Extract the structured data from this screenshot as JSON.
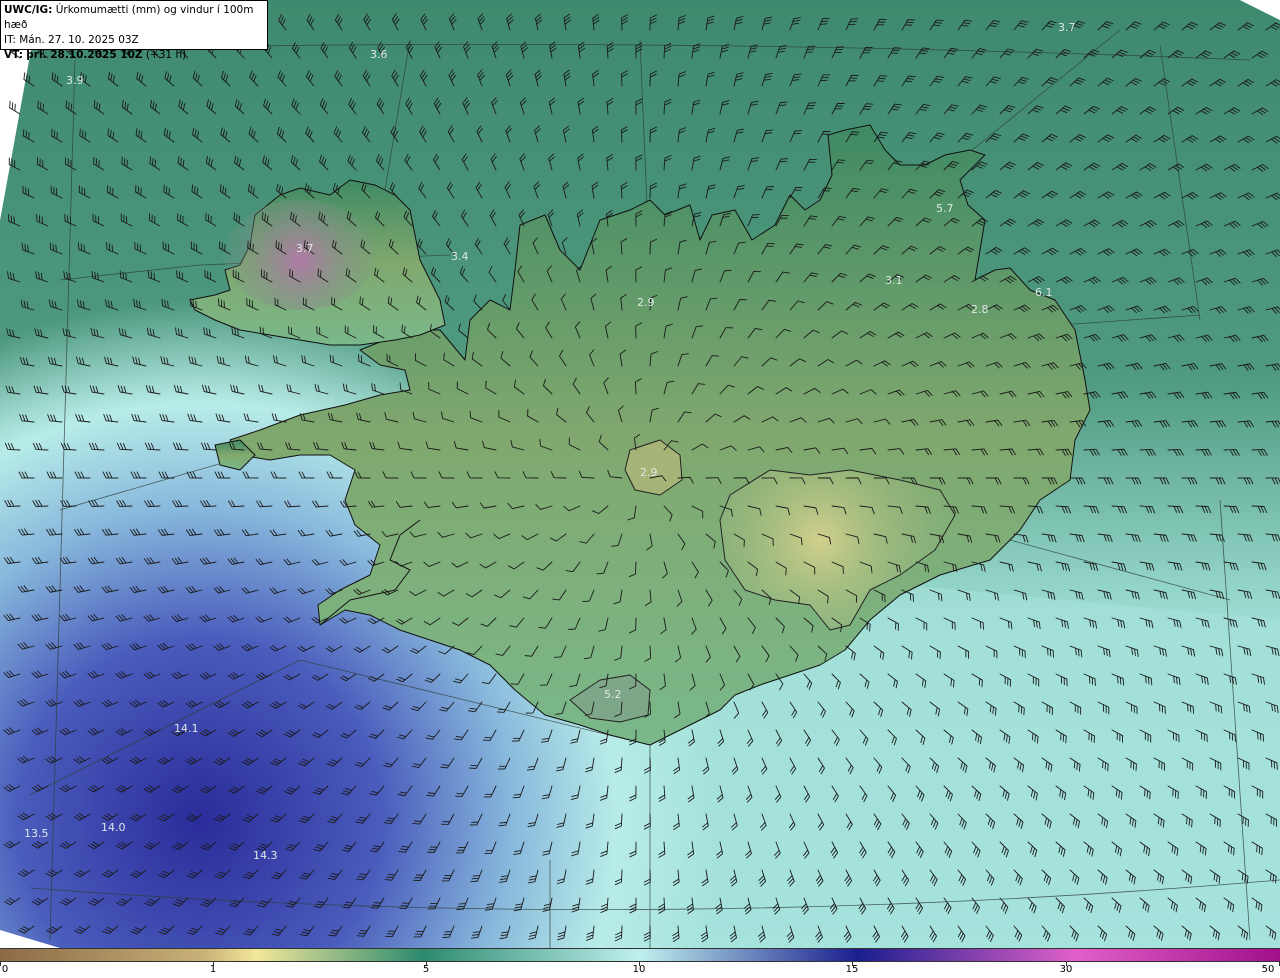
{
  "header": {
    "title_bold": "UWC/IG:",
    "title_rest": "Úrkomumætti (mm) og vindur í 100m hæð",
    "init_time": "IT: Mán. 27. 10. 2025 03Z",
    "valid_label": "VT:",
    "valid_bold": "þri. 28.10.2025 10Z",
    "valid_rest": "(+31 h)"
  },
  "colorbar": {
    "labels": [
      "0",
      "1",
      "5",
      "10",
      "15",
      "30",
      "50"
    ],
    "colors": [
      "#8c6a46",
      "#c9b278",
      "#f2e79a",
      "#2c8a6e",
      "#bff0ee",
      "#1a1e8e",
      "#e060c8",
      "#a0108a"
    ]
  },
  "point_values": [
    {
      "text": "3.9"
    },
    {
      "text": "3.6"
    },
    {
      "text": "3.7"
    },
    {
      "text": "3.7"
    },
    {
      "text": "3.4"
    },
    {
      "text": "2.9"
    },
    {
      "text": "3.1"
    },
    {
      "text": "5.7"
    },
    {
      "text": "2.8"
    },
    {
      "text": "6.1"
    },
    {
      "text": "2.9"
    },
    {
      "text": "5.2"
    },
    {
      "text": "14.1"
    },
    {
      "text": "13.5"
    },
    {
      "text": "14.0"
    },
    {
      "text": "14.3"
    }
  ]
}
